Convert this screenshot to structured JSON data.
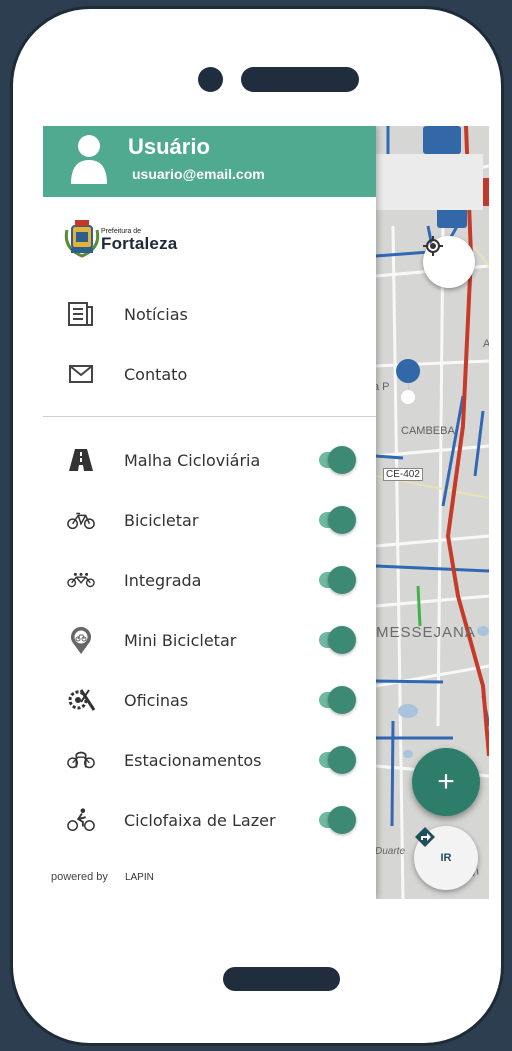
{
  "header": {
    "user_name": "Usuário",
    "user_email": "usuario@email.com"
  },
  "logo": {
    "small_text": "Prefeitura de",
    "big_text": "Fortaleza"
  },
  "menu": [
    {
      "label": "Notícias",
      "icon": "news-icon"
    },
    {
      "label": "Contato",
      "icon": "mail-icon"
    }
  ],
  "layers": [
    {
      "label": "Malha Cicloviária",
      "icon": "road-icon",
      "enabled": true
    },
    {
      "label": "Bicicletar",
      "icon": "bicycle-icon",
      "enabled": true
    },
    {
      "label": "Integrada",
      "icon": "tandem-bicycle-icon",
      "enabled": true
    },
    {
      "label": "Mini Bicicletar",
      "icon": "map-pin-bike-icon",
      "enabled": true
    },
    {
      "label": "Oficinas",
      "icon": "tools-gear-icon",
      "enabled": true
    },
    {
      "label": "Estacionamentos",
      "icon": "bike-parking-icon",
      "enabled": true
    },
    {
      "label": "Ciclofaixa de Lazer",
      "icon": "cyclist-icon",
      "enabled": true
    }
  ],
  "footer": {
    "powered_by": "powered by",
    "brand": "LAPIN"
  },
  "map": {
    "labels": {
      "cambeba": "CAMBEBA",
      "messejana": "MESSEJANA",
      "ce402": "CE-402",
      "duarte": "Duarte",
      "anel": "Anel Vi",
      "a": "A",
      "pa": "a P"
    },
    "ir_label": "IR",
    "fab_label": "+"
  },
  "colors": {
    "accent": "#4faa8f",
    "toggle_knob": "#3d8a74",
    "fab": "#2e7d6a",
    "background": "#2c3e4f"
  }
}
